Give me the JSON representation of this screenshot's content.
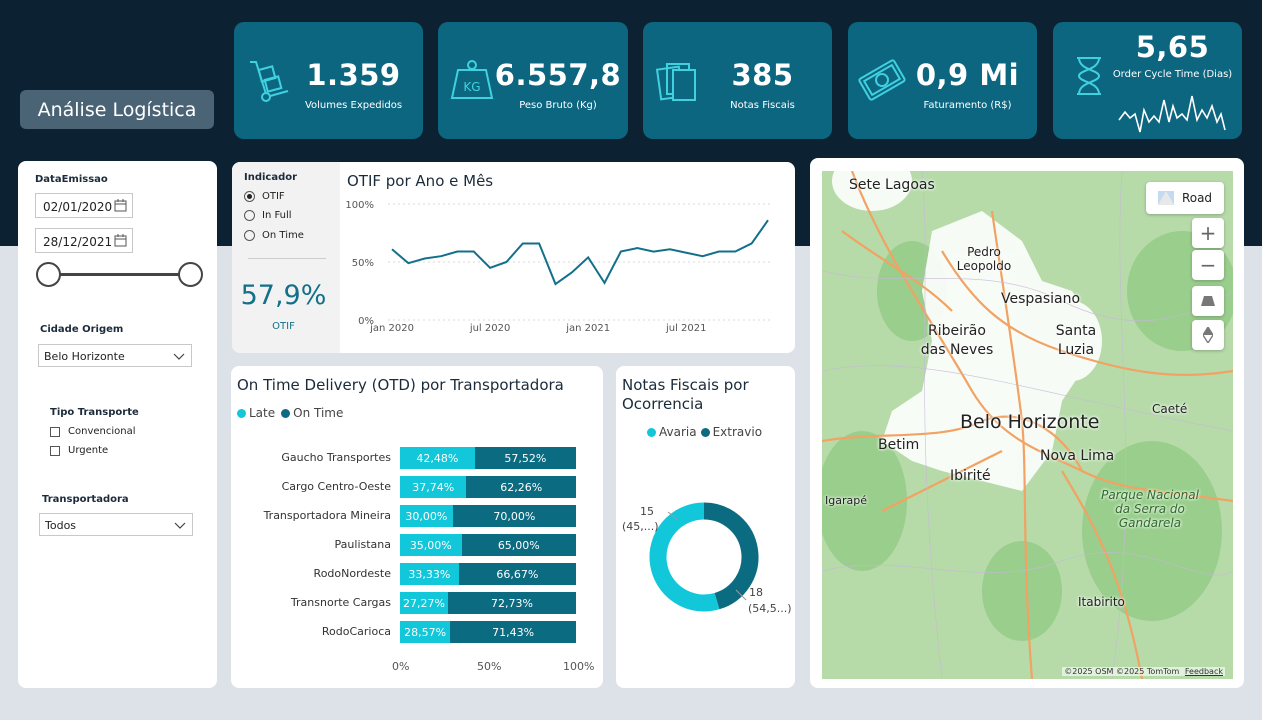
{
  "header": {
    "title": "Análise Logística"
  },
  "kpis": [
    {
      "value": "1.359",
      "label": "Volumes Expedidos",
      "icon": "hand-truck-icon"
    },
    {
      "value": "6.557,8",
      "label": "Peso Bruto (Kg)",
      "icon": "kg-weight-icon"
    },
    {
      "value": "385",
      "label": "Notas Fiscais",
      "icon": "documents-icon"
    },
    {
      "value": "0,9 Mi",
      "label": "Faturamento (R$)",
      "icon": "money-icon"
    },
    {
      "value": "5,65",
      "label": "Order Cycle Time (Dias)",
      "icon": "hourglass-icon"
    }
  ],
  "filters": {
    "date_label": "DataEmissao",
    "date_start": "02/01/2020",
    "date_end": "28/12/2021",
    "cidade_label": "Cidade Origem",
    "cidade_value": "Belo Horizonte",
    "tipo_label": "Tipo Transporte",
    "tipo_options": [
      "Convencional",
      "Urgente"
    ],
    "transp_label": "Transportadora",
    "transp_value": "Todos"
  },
  "indicator": {
    "label": "Indicador",
    "options": [
      "OTIF",
      "In Full",
      "On Time"
    ],
    "selected": "OTIF",
    "value": "57,9%",
    "value_label": "OTIF"
  },
  "otif_chart": {
    "title": "OTIF por Ano e Mês",
    "y_ticks": [
      "100%",
      "50%",
      "0%"
    ],
    "x_ticks": [
      "jan 2020",
      "jul 2020",
      "jan 2021",
      "jul 2021"
    ]
  },
  "otd_chart": {
    "title": "On Time Delivery (OTD) por Transportadora",
    "legend": [
      "Late",
      "On Time"
    ],
    "x_ticks": [
      "0%",
      "50%",
      "100%"
    ]
  },
  "nf_chart": {
    "title_line1": "Notas Fiscais por",
    "title_line2": "Ocorrencia",
    "legend": [
      "Avaria",
      "Extravio"
    ],
    "label_a_1": "15",
    "label_a_2": "(45,...)",
    "label_b_1": "18",
    "label_b_2": "(54,5...)"
  },
  "map": {
    "road_label": "Road",
    "attribution": "©2025 OSM  ©2025 TomTom",
    "feedback": "Feedback",
    "places": [
      "Sete Lagoas",
      "Pedro Leopoldo",
      "Vespasiano",
      "Ribeirão das Neves",
      "Santa Luzia",
      "Caeté",
      "Belo Horizonte",
      "Betim",
      "Nova Lima",
      "Ibirité",
      "Igarapé",
      "Parque Nacional da Serra do Gandarela",
      "Itabirito"
    ]
  },
  "chart_data": [
    {
      "type": "line",
      "title": "OTIF por Ano e Mês",
      "x": [
        "2020-01",
        "2020-02",
        "2020-03",
        "2020-04",
        "2020-05",
        "2020-06",
        "2020-07",
        "2020-08",
        "2020-09",
        "2020-10",
        "2020-11",
        "2020-12",
        "2021-01",
        "2021-02",
        "2021-03",
        "2021-04",
        "2021-05",
        "2021-06",
        "2021-07",
        "2021-08",
        "2021-09",
        "2021-10",
        "2021-11",
        "2021-12"
      ],
      "values": [
        0.61,
        0.49,
        0.53,
        0.55,
        0.59,
        0.59,
        0.45,
        0.5,
        0.66,
        0.66,
        0.31,
        0.41,
        0.54,
        0.32,
        0.59,
        0.62,
        0.59,
        0.61,
        0.58,
        0.55,
        0.59,
        0.59,
        0.66,
        0.86
      ],
      "ylim": [
        0,
        1
      ],
      "colors": {
        "line": "#13708a"
      }
    },
    {
      "type": "bar",
      "title": "On Time Delivery (OTD) por Transportadora",
      "categories": [
        "Gaucho Transportes",
        "Cargo Centro-Oeste",
        "Transportadora Mineira",
        "Paulistana",
        "RodoNordeste",
        "Transnorte Cargas",
        "RodoCarioca"
      ],
      "series": [
        {
          "name": "Late",
          "values": [
            42.48,
            37.74,
            30.0,
            35.0,
            33.33,
            27.27,
            28.57
          ],
          "labels": [
            "42,48%",
            "37,74%",
            "30,00%",
            "35,00%",
            "33,33%",
            "27,27%",
            "28,57%"
          ],
          "color": "#12c7d9"
        },
        {
          "name": "On Time",
          "values": [
            57.52,
            62.26,
            70.0,
            65.0,
            66.67,
            72.73,
            71.43
          ],
          "labels": [
            "57,52%",
            "62,26%",
            "70,00%",
            "65,00%",
            "66,67%",
            "72,73%",
            "71,43%"
          ],
          "color": "#0b6b80"
        }
      ],
      "xlim": [
        0,
        100
      ]
    },
    {
      "type": "pie",
      "title": "Notas Fiscais por Ocorrencia",
      "categories": [
        "Avaria",
        "Extravio"
      ],
      "values": [
        15,
        18
      ],
      "colors": [
        "#12c7d9",
        "#0b6b80"
      ]
    }
  ]
}
